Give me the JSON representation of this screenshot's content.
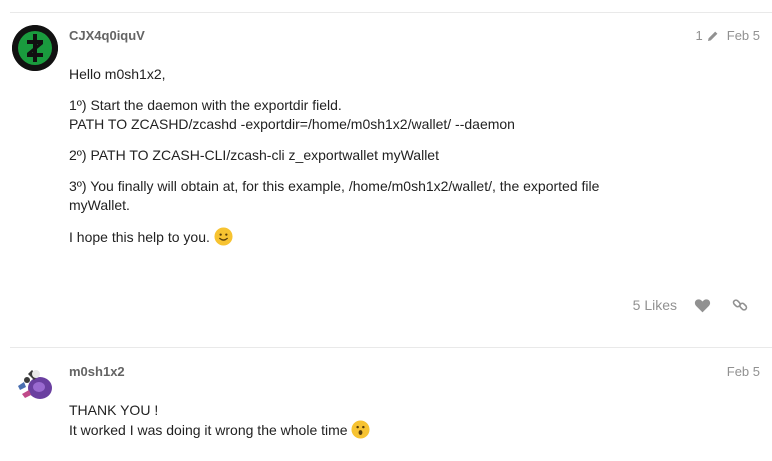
{
  "posts": [
    {
      "username": "CJX4q0iquV",
      "edit_count": "1",
      "date": "Feb 5",
      "lines": [
        "Hello m0sh1x2,",
        "1º) Start the daemon with the exportdir field.",
        "PATH TO ZCASHD/zcashd -exportdir=/home/m0sh1x2/wallet/ --daemon",
        "2º) PATH TO ZCASH-CLI/zcash-cli z_exportwallet myWallet",
        "3º) You finally will obtain at, for this example, /home/m0sh1x2/wallet/, the exported file",
        "myWallet.",
        "I hope this help to you."
      ],
      "likes_label": "5 Likes"
    },
    {
      "username": "m0sh1x2",
      "date": "Feb 5",
      "lines": [
        "THANK YOU !",
        "It worked I was doing it wrong the whole time"
      ]
    }
  ],
  "colors": {
    "zcash_green": "#1a9b3e",
    "meta_gray": "#919191",
    "emoji_yellow": "#f7c331"
  },
  "icons": [
    "zcash-avatar-icon",
    "pencil-icon",
    "heart-icon",
    "link-icon",
    "slight-smile-emoji-icon",
    "astonished-emoji-icon"
  ]
}
